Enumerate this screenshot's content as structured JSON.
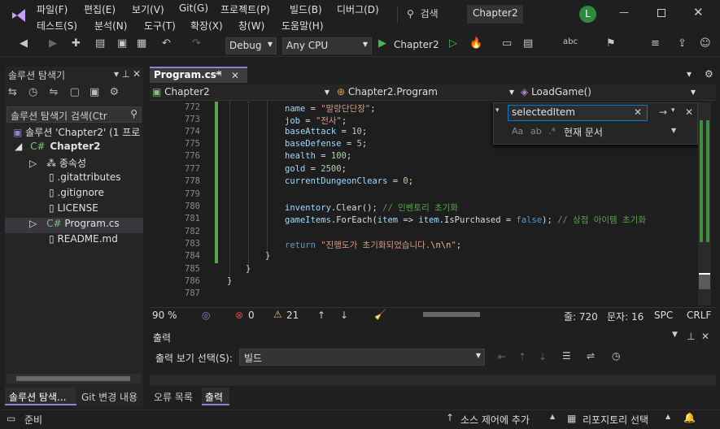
{
  "menu": {
    "row1": [
      "파일(F)",
      "편집(E)",
      "보기(V)",
      "Git(G)",
      "프로젝트(P)",
      "빌드(B)",
      "디버그(D)"
    ],
    "row2": [
      "테스트(S)",
      "분석(N)",
      "도구(T)",
      "확장(X)",
      "창(W)",
      "도움말(H)"
    ],
    "search": "검색",
    "solution_title": "Chapter2",
    "user_initial": "L"
  },
  "toolbar": {
    "config": "Debug",
    "platform": "Any CPU",
    "run_target": "Chapter2"
  },
  "sidebar": {
    "title": "솔루션 탐색기",
    "search_placeholder": "솔루션 탐색기 검색(Ctr",
    "items": [
      {
        "label": "솔루션 'Chapter2' (1 프로"
      },
      {
        "label": "Chapter2"
      },
      {
        "label": "종속성"
      },
      {
        "label": ".gitattributes"
      },
      {
        "label": ".gitignore"
      },
      {
        "label": "LICENSE"
      },
      {
        "label": "Program.cs"
      },
      {
        "label": "README.md"
      }
    ]
  },
  "editor": {
    "tab": "Program.cs*",
    "nav": {
      "project": "Chapter2",
      "class": "Chapter2.Program",
      "member": "LoadGame()"
    },
    "find": {
      "query": "selectedItem",
      "scope": "현재 문서"
    },
    "line_numbers": [
      "772",
      "773",
      "774",
      "775",
      "776",
      "777",
      "778",
      "779",
      "780",
      "781",
      "782",
      "783",
      "784",
      "785",
      "786",
      "787"
    ],
    "zoom": "90 %",
    "errors": "0",
    "warnings": "21",
    "line": "줄: 720",
    "column": "문자: 16",
    "spc": "SPC",
    "crlf": "CRLF"
  },
  "output": {
    "title": "출력",
    "label": "출력 보기 선택(S):",
    "source": "빌드"
  },
  "bottom_tabs": [
    "솔루션 탐색...",
    "Git 변경 내용",
    "오류 목록",
    "출력"
  ],
  "status": {
    "ready": "준비",
    "source_control": "소스 제어에 추가",
    "repo": "리포지토리 선택"
  },
  "colors": {
    "accent": "#3c8f3c",
    "modified_bar": "#57a64a"
  }
}
